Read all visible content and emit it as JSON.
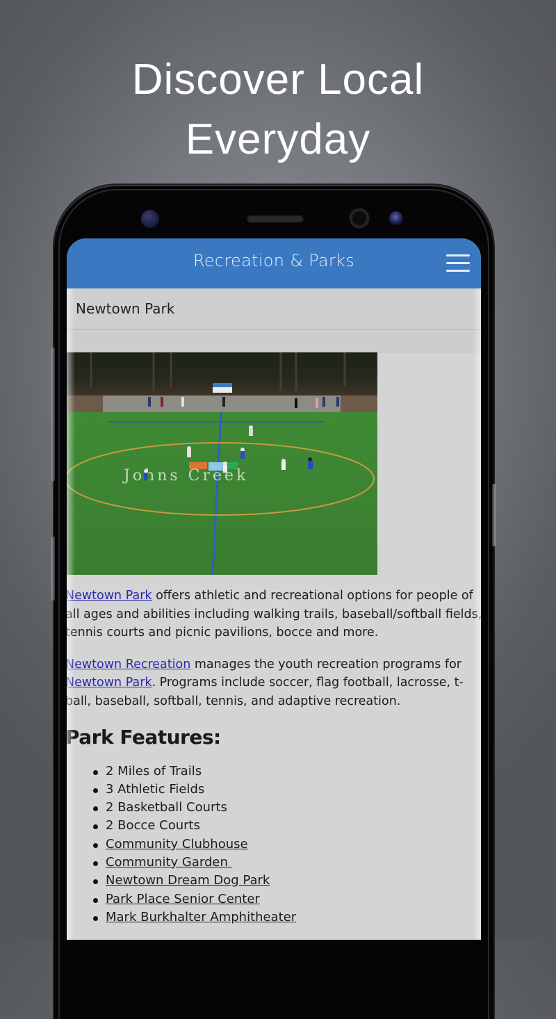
{
  "promo": {
    "headline_line1": "Discover Local",
    "headline_line2": "Everyday"
  },
  "app": {
    "title": "Recreation & Parks",
    "menu_icon": "hamburger-menu-icon",
    "brand_color": "#3b78c2"
  },
  "page": {
    "heading": "Newtown Park",
    "hero_image_alt": "Lacrosse game on Johns Creek turf field",
    "hero_field_text": "Johns Creek"
  },
  "body": {
    "para1": {
      "link": "Newtown Park",
      "text": " offers athletic and recreational options for people of",
      "line2": "all ages and abilities including walking trails, baseball/softball fields,",
      "line3": "tennis courts and picnic pavilions, bocce and more."
    },
    "para2": {
      "link1": "Newtown Recreation",
      "text1": " manages the youth recreation programs for",
      "link2": "Newtown Park",
      "text2": ". Programs include soccer, flag football, lacrosse, t-",
      "line3": "ball, baseball, softball, tennis, and adaptive recreation."
    },
    "features_title": "Park Features:",
    "features": [
      {
        "label": "2 Miles of Trails",
        "link": false
      },
      {
        "label": "3 Athletic Fields",
        "link": false
      },
      {
        "label": "2 Basketball Courts",
        "link": false
      },
      {
        "label": "2 Bocce Courts",
        "link": false
      },
      {
        "label": "Community Clubhouse",
        "link": true
      },
      {
        "label": "Community Garden ",
        "link": true
      },
      {
        "label": "Newtown Dream Dog Park",
        "link": true
      },
      {
        "label": "Park Place Senior Center",
        "link": true
      },
      {
        "label": "Mark Burkhalter Amphitheater",
        "link": true
      }
    ]
  }
}
